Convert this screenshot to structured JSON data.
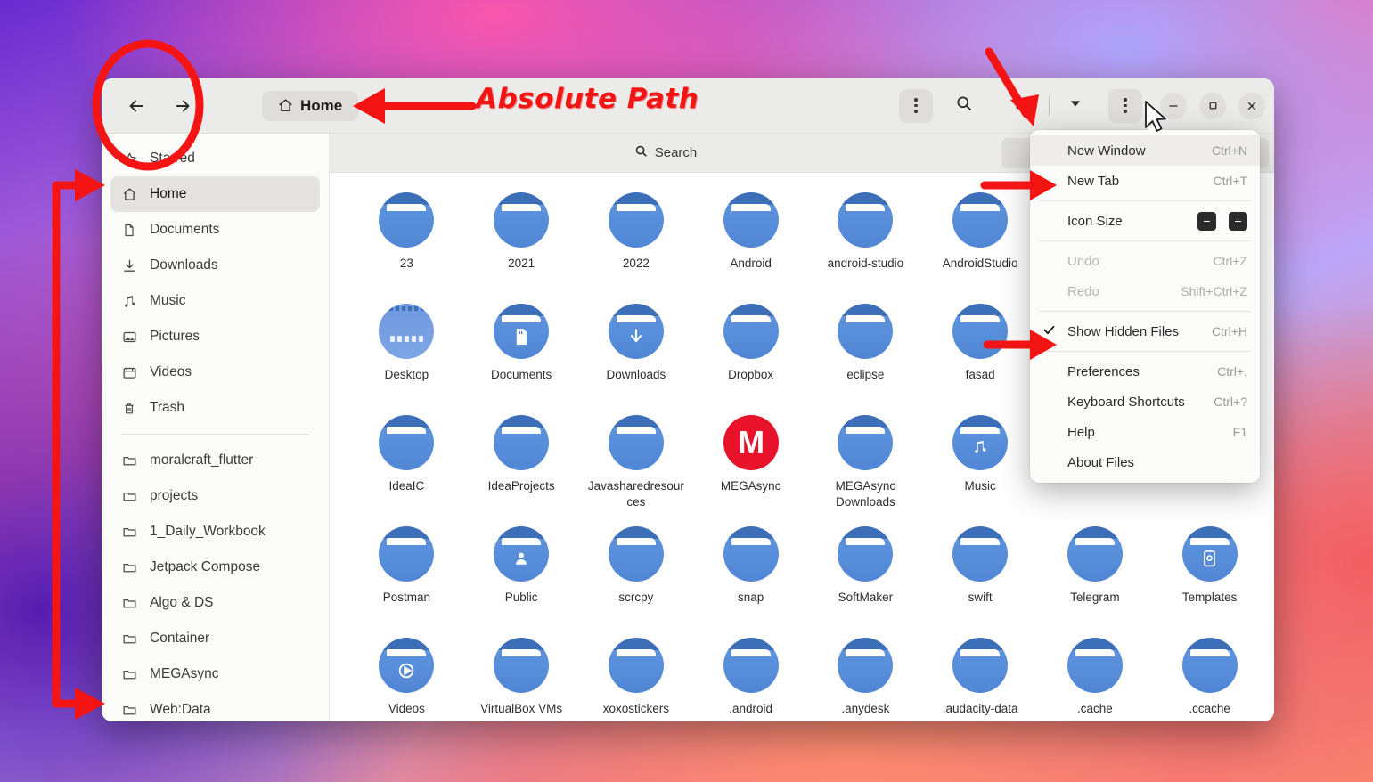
{
  "annotation": {
    "absolute_path_label": "Absolute Path",
    "accent_color": "#f51414"
  },
  "window": {
    "headerbar": {
      "back_icon": "arrow-left-icon",
      "forward_icon": "arrow-right-icon",
      "path_label": "Home",
      "path_icon": "home-icon",
      "view_options_icon": "vertical-dots-icon",
      "search_icon": "search-icon",
      "list_view_icon": "list-view-icon",
      "view_dropdown_icon": "chevron-down-icon",
      "main_menu_icon": "vertical-dots-icon",
      "minimize_label": "−",
      "maximize_label": "□",
      "close_label": "×"
    },
    "tabs": [
      {
        "label": "Search",
        "icon": "search-icon",
        "active": false
      },
      {
        "label": "Home",
        "icon": "",
        "active": true
      }
    ],
    "sidebar": {
      "groups": [
        {
          "items": [
            {
              "label": "Starred",
              "icon": "star-icon",
              "selected": false
            },
            {
              "label": "Home",
              "icon": "home-icon",
              "selected": true
            },
            {
              "label": "Documents",
              "icon": "document-icon",
              "selected": false
            },
            {
              "label": "Downloads",
              "icon": "download-icon",
              "selected": false
            },
            {
              "label": "Music",
              "icon": "music-note-icon",
              "selected": false
            },
            {
              "label": "Pictures",
              "icon": "image-icon",
              "selected": false
            },
            {
              "label": "Videos",
              "icon": "video-icon",
              "selected": false
            },
            {
              "label": "Trash",
              "icon": "trash-icon",
              "selected": false
            }
          ]
        },
        {
          "items": [
            {
              "label": "moralcraft_flutter",
              "icon": "folder-icon",
              "selected": false
            },
            {
              "label": "projects",
              "icon": "folder-icon",
              "selected": false
            },
            {
              "label": "1_Daily_Workbook",
              "icon": "folder-icon",
              "selected": false
            },
            {
              "label": "Jetpack Compose",
              "icon": "folder-icon",
              "selected": false
            },
            {
              "label": "Algo & DS",
              "icon": "folder-icon",
              "selected": false
            },
            {
              "label": "Container",
              "icon": "folder-icon",
              "selected": false
            },
            {
              "label": "MEGAsync",
              "icon": "folder-icon",
              "selected": false
            },
            {
              "label": "Web:Data",
              "icon": "folder-icon",
              "selected": false
            }
          ]
        }
      ]
    },
    "files": [
      {
        "name": "23",
        "type": "folder"
      },
      {
        "name": "2021",
        "type": "folder"
      },
      {
        "name": "2022",
        "type": "folder"
      },
      {
        "name": "Android",
        "type": "folder"
      },
      {
        "name": "android-studio",
        "type": "folder"
      },
      {
        "name": "AndroidStudio",
        "type": "folder"
      },
      {
        "name": "",
        "type": "hidden-col7"
      },
      {
        "name": "",
        "type": "hidden-col8"
      },
      {
        "name": "Desktop",
        "type": "desktop-folder"
      },
      {
        "name": "Documents",
        "type": "folder-badge",
        "badge": "document-icon"
      },
      {
        "name": "Downloads",
        "type": "folder-badge",
        "badge": "download-arrow-icon"
      },
      {
        "name": "Dropbox",
        "type": "folder"
      },
      {
        "name": "eclipse",
        "type": "folder"
      },
      {
        "name": "fasad",
        "type": "folder"
      },
      {
        "name": "",
        "type": "hidden-col7"
      },
      {
        "name": "",
        "type": "hidden-col8"
      },
      {
        "name": "IdeaIC",
        "type": "folder"
      },
      {
        "name": "IdeaProjects",
        "type": "folder"
      },
      {
        "name": "Javasharedresources",
        "type": "folder"
      },
      {
        "name": "MEGAsync",
        "type": "mega",
        "badge_text": "M"
      },
      {
        "name": "MEGAsync Downloads",
        "type": "folder"
      },
      {
        "name": "Music",
        "type": "folder-badge",
        "badge": "music-note-icon"
      },
      {
        "name": "",
        "type": "hidden-col7"
      },
      {
        "name": "",
        "type": "hidden-col8"
      },
      {
        "name": "Postman",
        "type": "folder"
      },
      {
        "name": "Public",
        "type": "folder-badge",
        "badge": "person-icon"
      },
      {
        "name": "scrcpy",
        "type": "folder"
      },
      {
        "name": "snap",
        "type": "folder"
      },
      {
        "name": "SoftMaker",
        "type": "folder"
      },
      {
        "name": "swift",
        "type": "folder"
      },
      {
        "name": "Telegram",
        "type": "folder"
      },
      {
        "name": "Templates",
        "type": "folder-badge",
        "badge": "template-icon"
      },
      {
        "name": "Videos",
        "type": "folder-badge",
        "badge": "play-icon"
      },
      {
        "name": "VirtualBox VMs",
        "type": "folder"
      },
      {
        "name": "xoxostickers",
        "type": "folder"
      },
      {
        "name": ".android",
        "type": "folder"
      },
      {
        "name": ".anydesk",
        "type": "folder"
      },
      {
        "name": ".audacity-data",
        "type": "folder"
      },
      {
        "name": ".cache",
        "type": "folder"
      },
      {
        "name": ".ccache",
        "type": "folder"
      }
    ],
    "menu": {
      "items": [
        {
          "label": "New Window",
          "accel": "Ctrl+N",
          "state": "highlighted"
        },
        {
          "label": "New Tab",
          "accel": "Ctrl+T",
          "state": "normal"
        },
        {
          "separator": true
        },
        {
          "label": "Icon Size",
          "accel": "",
          "state": "normal",
          "controls": [
            "minus",
            "plus"
          ]
        },
        {
          "separator": true
        },
        {
          "label": "Undo",
          "accel": "Ctrl+Z",
          "state": "disabled"
        },
        {
          "label": "Redo",
          "accel": "Shift+Ctrl+Z",
          "state": "disabled"
        },
        {
          "separator": true
        },
        {
          "label": "Show Hidden Files",
          "accel": "Ctrl+H",
          "state": "checked"
        },
        {
          "separator": true
        },
        {
          "label": "Preferences",
          "accel": "Ctrl+,",
          "state": "normal"
        },
        {
          "label": "Keyboard Shortcuts",
          "accel": "Ctrl+?",
          "state": "normal"
        },
        {
          "label": "Help",
          "accel": "F1",
          "state": "normal"
        },
        {
          "label": "About Files",
          "accel": "",
          "state": "normal"
        }
      ],
      "icon_size_minus": "−",
      "icon_size_plus": "+"
    }
  }
}
